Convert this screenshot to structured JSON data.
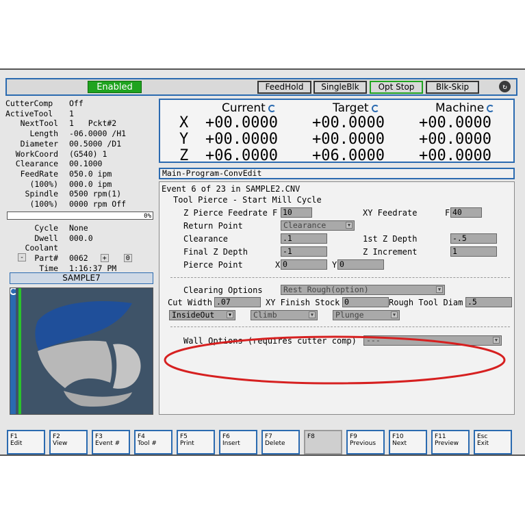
{
  "status": {
    "label": "Enabled",
    "color": "#1fa31f"
  },
  "toolbar": {
    "feedhold": "FeedHold",
    "singleblk": "SingleBlk",
    "optstop": "Opt Stop",
    "blkskip": "Blk-Skip"
  },
  "left_info": [
    {
      "label": "CutterComp",
      "value": "Off"
    },
    {
      "label": "ActiveTool",
      "value": "1"
    },
    {
      "label": "NextTool",
      "value": "1   Pckt#2"
    },
    {
      "label": "Length",
      "value": "-06.0000 /H1"
    },
    {
      "label": "Diameter",
      "value": "00.5000 /D1"
    },
    {
      "label": "WorkCoord",
      "value": "(G540) 1"
    },
    {
      "label": "Clearance",
      "value": "00.1000"
    },
    {
      "label": "FeedRate",
      "value": "050.0 ipm"
    },
    {
      "label": "(100%)",
      "value": "000.0 ipm"
    },
    {
      "label": "Spindle",
      "value": "0500 rpm(1)"
    },
    {
      "label": "(100%)",
      "value": "0000 rpm Off"
    }
  ],
  "progress": {
    "label": "0%",
    "fraction": 0
  },
  "cycle": {
    "cycle_label": "Cycle",
    "cycle_value": "None",
    "dwell_label": "Dwell",
    "dwell_value": "000.0",
    "coolant_label": "Coolant",
    "part_minus": "-",
    "part_label": "Part#",
    "part_value": "0062",
    "part_plus": "+",
    "part_zero": "0",
    "time_label": "Time",
    "time_value": "1:16:37 PM"
  },
  "program_name": "SAMPLE7",
  "dro": {
    "headers": [
      "Current",
      "Target",
      "Machine"
    ],
    "axes": [
      "X",
      "Y",
      "Z"
    ],
    "current": [
      "+00.0000",
      "+00.0000",
      "+06.0000"
    ],
    "target": [
      "+00.0000",
      "+00.0000",
      "+06.0000"
    ],
    "machine": [
      "+00.0000",
      "+00.0000",
      "+00.0000"
    ]
  },
  "editor": {
    "title": "Main-Program-ConvEdit",
    "event_line": "Event 6 of 23 in SAMPLE2.CNV",
    "cycle_title": "Tool Pierce - Start Mill Cycle",
    "z_pierce_feed_label": "Z Pierce Feedrate F",
    "z_pierce_feed": "10",
    "xy_feed_label": "XY Feedrate",
    "xy_feed_prefix": "F",
    "xy_feed": "40",
    "return_point_label": "Return Point",
    "return_point": "Clearance",
    "clearance_label": "Clearance",
    "clearance": ".1",
    "first_z_label": "1st Z Depth",
    "first_z": "-.5",
    "final_z_label": "Final Z Depth",
    "final_z": "-1",
    "z_inc_label": "Z Increment",
    "z_inc": "1",
    "pierce_label": "Pierce Point",
    "pierce_x_prefix": "X",
    "pierce_x": "0",
    "pierce_y_prefix": "Y",
    "pierce_y": "0",
    "clearing_label": "Clearing Options",
    "clearing": "Rest Rough(option)",
    "cut_width_label": "Cut Width",
    "cut_width": ".07",
    "xy_finish_label": "XY Finish Stock",
    "xy_finish": "0",
    "rough_diam_label": "Rough Tool Diam",
    "rough_diam": ".5",
    "insideout": "InsideOut",
    "climb": "Climb",
    "plunge": "Plunge",
    "wall_label": "Wall Options (requires cutter comp)",
    "wall": "---"
  },
  "fkeys": [
    {
      "key": "F1",
      "label": "Edit"
    },
    {
      "key": "F2",
      "label": "View"
    },
    {
      "key": "F3",
      "label": "Event #"
    },
    {
      "key": "F4",
      "label": "Tool #"
    },
    {
      "key": "F5",
      "label": "Print"
    },
    {
      "key": "F6",
      "label": "Insert"
    },
    {
      "key": "F7",
      "label": "Delete"
    },
    {
      "key": "F8",
      "label": ""
    },
    {
      "key": "F9",
      "label": "Previous"
    },
    {
      "key": "F10",
      "label": "Next"
    },
    {
      "key": "F11",
      "label": "Preview"
    },
    {
      "key": "Esc",
      "label": "Exit"
    }
  ],
  "colors": {
    "accent": "#2a6ab0",
    "highlight_ellipse": "#d62020"
  }
}
